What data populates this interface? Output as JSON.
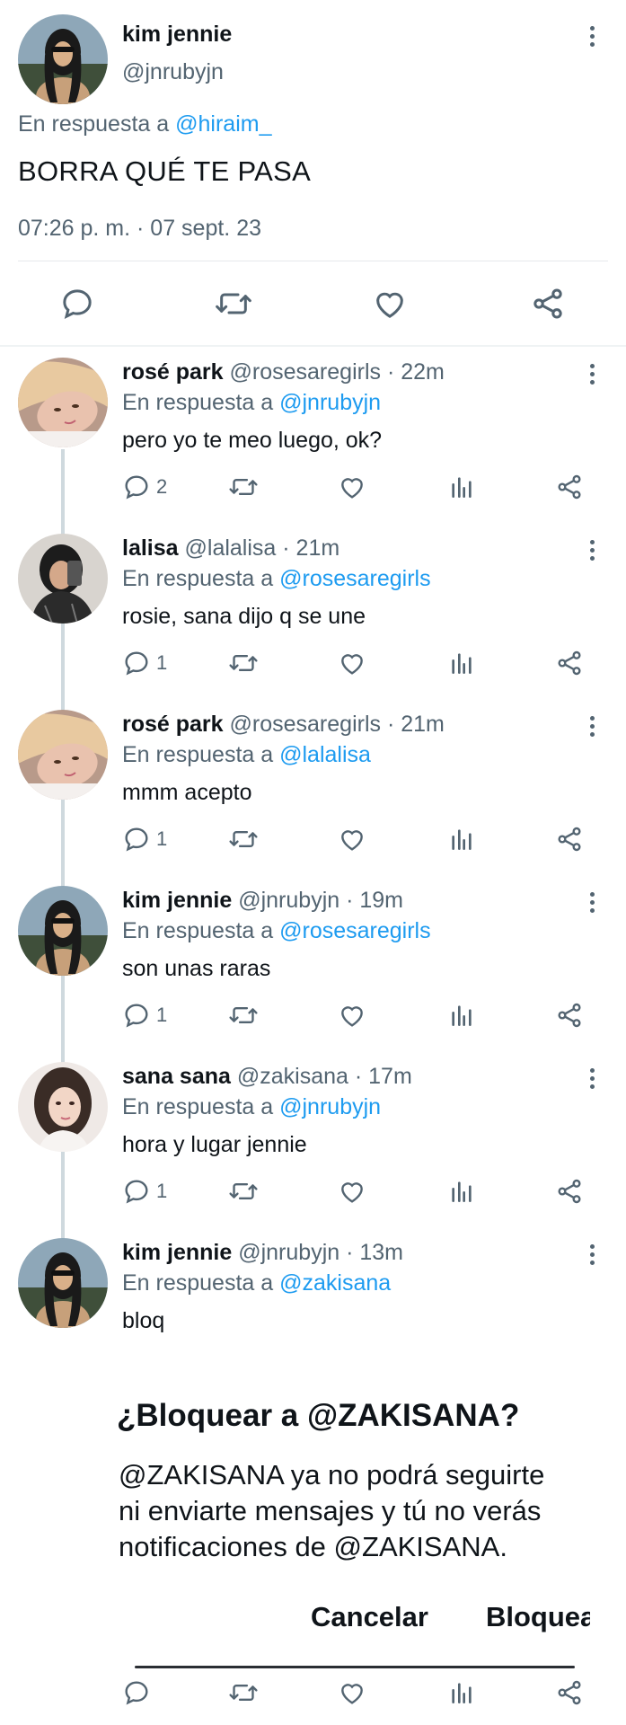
{
  "main_tweet": {
    "name": "kim jennie",
    "handle": "@jnrubyjn",
    "reply_prefix": "En respuesta a ",
    "reply_to": "@hiraim_",
    "text": "BORRA QUÉ TE PASA",
    "timestamp": "07:26 p. m. · 07 sept. 23"
  },
  "replies": [
    {
      "name": "rosé park",
      "handle": "@rosesaregirls · 22m",
      "reply_prefix": "En respuesta a ",
      "reply_to": "@jnrubyjn",
      "text": "pero yo te meo luego, ok?",
      "reply_count": "2"
    },
    {
      "name": "lalisa",
      "handle": "@lalalisa · 21m",
      "reply_prefix": "En respuesta a ",
      "reply_to": "@rosesaregirls",
      "text": "rosie, sana dijo q se une",
      "reply_count": "1"
    },
    {
      "name": "rosé park",
      "handle": "@rosesaregirls · 21m",
      "reply_prefix": "En respuesta a ",
      "reply_to": "@lalalisa",
      "text": "mmm acepto",
      "reply_count": "1"
    },
    {
      "name": "kim jennie",
      "handle": "@jnrubyjn · 19m",
      "reply_prefix": "En respuesta a ",
      "reply_to": "@rosesaregirls",
      "text": "son unas raras",
      "reply_count": "1"
    },
    {
      "name": "sana sana",
      "handle": "@zakisana · 17m",
      "reply_prefix": "En respuesta a ",
      "reply_to": "@jnrubyjn",
      "text": "hora y lugar jennie",
      "reply_count": "1"
    },
    {
      "name": "kim jennie",
      "handle": "@jnrubyjn · 13m",
      "reply_prefix": "En respuesta a ",
      "reply_to": "@zakisana",
      "text": "bloq",
      "reply_count": ""
    }
  ],
  "dialog": {
    "title": "¿Bloquear a @ZAKISANA?",
    "body_line1": "@ZAKISANA ya no podrá seguirte",
    "body_line2": "ni enviarte mensajes y tú no verás",
    "body_line3": "notificaciones de @ZAKISANA.",
    "cancel_label": "Cancelar",
    "block_label": "Bloquear"
  },
  "colors": {
    "link": "#1d9bf0",
    "secondary_text": "#536471",
    "primary_text": "#0f1419",
    "thread_line": "#cfd9de"
  }
}
